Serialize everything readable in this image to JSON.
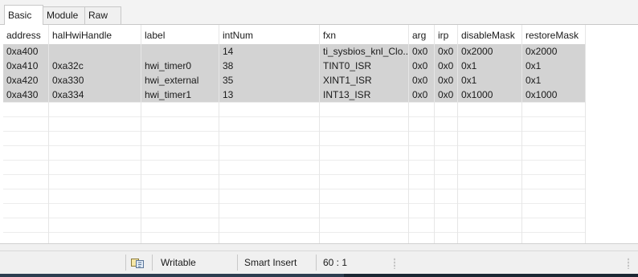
{
  "tabs": [
    {
      "label": "Basic",
      "active": true
    },
    {
      "label": "Module",
      "active": false
    },
    {
      "label": "Raw",
      "active": false
    }
  ],
  "table": {
    "columns": [
      "address",
      "halHwiHandle",
      "label",
      "intNum",
      "fxn",
      "arg",
      "irp",
      "disableMask",
      "restoreMask"
    ],
    "rows": [
      [
        "0xa400",
        "",
        "",
        "14",
        "ti_sysbios_knl_Clo...",
        "0x0",
        "0x0",
        "0x2000",
        "0x2000"
      ],
      [
        "0xa410",
        "0xa32c",
        "hwi_timer0",
        "38",
        "TINT0_ISR",
        "0x0",
        "0x0",
        "0x1",
        "0x1"
      ],
      [
        "0xa420",
        "0xa330",
        "hwi_external",
        "35",
        "XINT1_ISR",
        "0x0",
        "0x0",
        "0x1",
        "0x1"
      ],
      [
        "0xa430",
        "0xa334",
        "hwi_timer1",
        "13",
        "INT13_ISR",
        "0x0",
        "0x0",
        "0x1000",
        "0x1000"
      ]
    ]
  },
  "statusbar": {
    "icon": "ime-icon",
    "writable": "Writable",
    "insert_mode": "Smart Insert",
    "position": "60 : 1"
  },
  "colors": {
    "selected_row": "#d3d3d3",
    "bottom_strip": "#2d3e50"
  }
}
